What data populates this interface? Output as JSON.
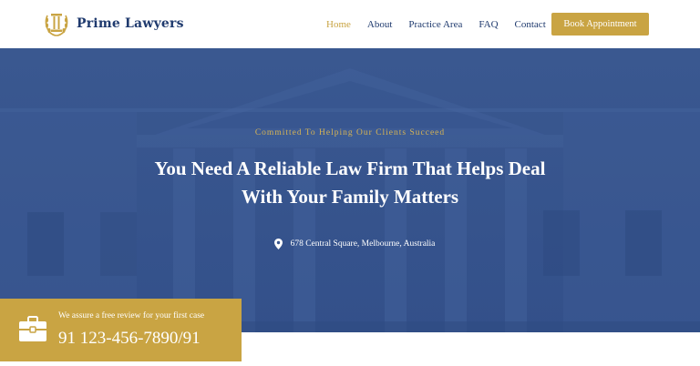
{
  "brand": {
    "name": "Prime Lawyers",
    "logo_icon": "column-laurel-icon"
  },
  "nav": {
    "items": [
      {
        "label": "Home",
        "active": true
      },
      {
        "label": "About",
        "active": false
      },
      {
        "label": "Practice Area",
        "active": false
      },
      {
        "label": "FAQ",
        "active": false
      },
      {
        "label": "Contact",
        "active": false
      }
    ],
    "cta_label": "Book Appointment"
  },
  "hero": {
    "eyebrow": "Committed To Helping Our Clients Succeed",
    "title_line1": "You Need A Reliable Law Firm That Helps Deal",
    "title_line2": "With Your Family Matters",
    "address": "678 Central Square, Melbourne, Australia",
    "address_icon": "map-pin-icon"
  },
  "review": {
    "label": "We assure a free review for your first case",
    "phone": "91 123-456-7890/91",
    "icon": "briefcase-icon"
  },
  "colors": {
    "primary": "#1f3a6e",
    "accent": "#c9a443",
    "hero_bg": "#38558e"
  }
}
